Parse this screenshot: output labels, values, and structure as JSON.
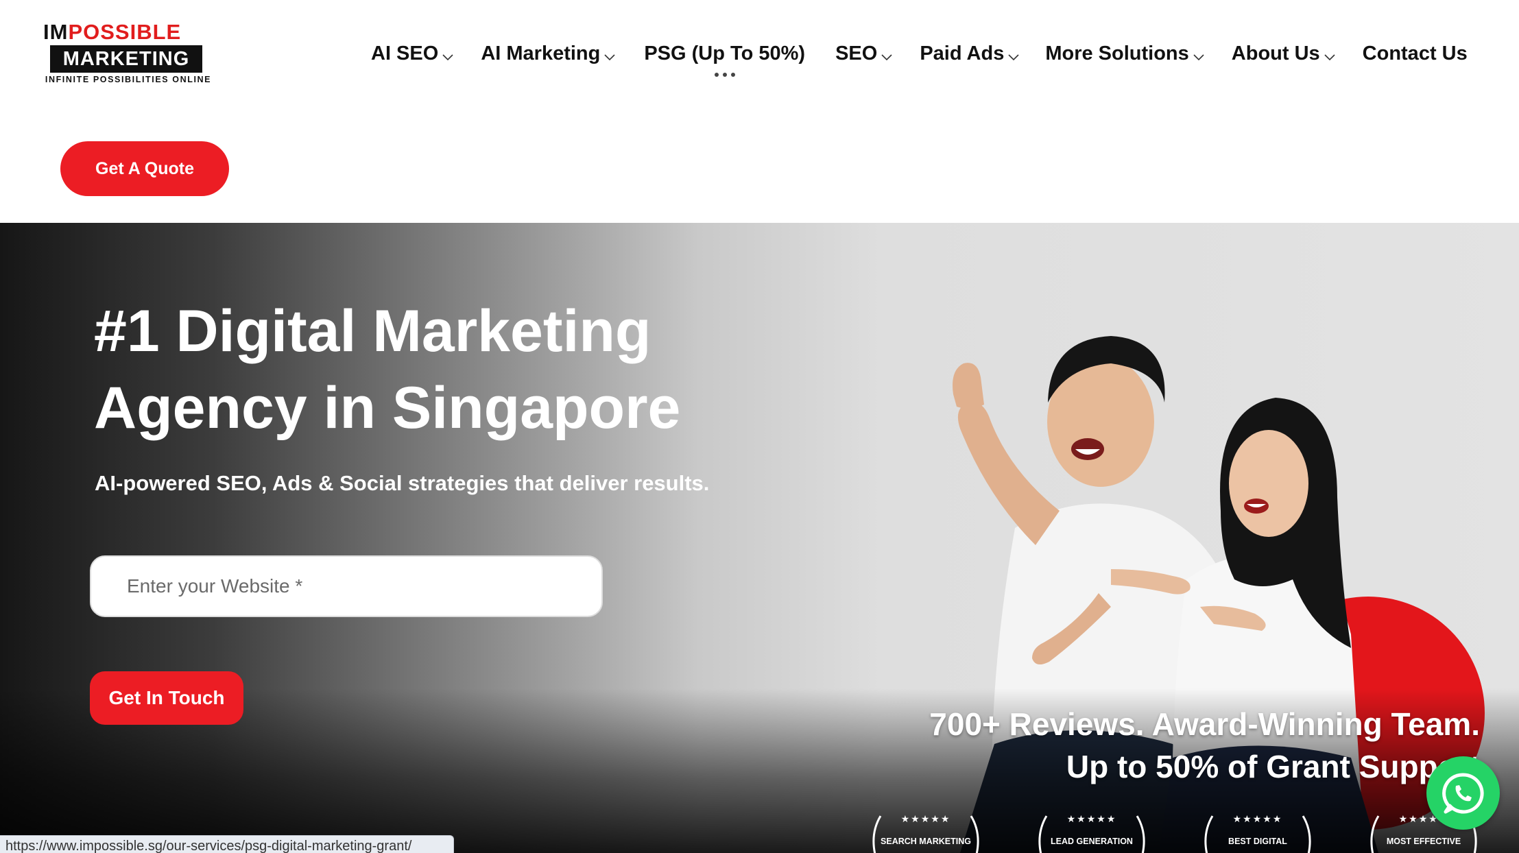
{
  "logo": {
    "line1_im": "IM",
    "line1_possible": "POSSIBLE",
    "line2": "MARKETING",
    "tagline": "INFINITE POSSIBILITIES ONLINE"
  },
  "nav": {
    "items": [
      {
        "label": "AI SEO",
        "has_dropdown": true
      },
      {
        "label": "AI Marketing",
        "has_dropdown": true
      },
      {
        "label": "PSG (Up To 50%)",
        "has_dropdown": false
      },
      {
        "label": "SEO",
        "has_dropdown": true
      },
      {
        "label": "Paid Ads",
        "has_dropdown": true
      },
      {
        "label": "More Solutions",
        "has_dropdown": true
      },
      {
        "label": "About Us",
        "has_dropdown": true
      },
      {
        "label": "Contact Us",
        "has_dropdown": false
      }
    ]
  },
  "header": {
    "quote_button": "Get A Quote"
  },
  "hero": {
    "title_line1": "#1 Digital Marketing",
    "title_line2": "Agency in Singapore",
    "subtitle": "AI-powered SEO, Ads & Social strategies that deliver results.",
    "website_placeholder": "Enter your Website *",
    "website_value": "",
    "cta_button": "Get In Touch",
    "reviews_line1": "700+ Reviews. Award-Winning Team.",
    "reviews_line2": "Up to 50% of Grant Support"
  },
  "awards": [
    {
      "stars": "★★★★★",
      "label": "SEARCH MARKETING"
    },
    {
      "stars": "★★★★★",
      "label": "LEAD GENERATION"
    },
    {
      "stars": "★★★★★",
      "label": "BEST DIGITAL"
    },
    {
      "stars": "★★★★★",
      "label": "MOST EFFECTIVE"
    }
  ],
  "status_bar": {
    "url": "https://www.impossible.sg/our-services/psg-digital-marketing-grant/"
  },
  "colors": {
    "brand_red": "#ec1d24",
    "logo_red": "#e11d1d",
    "whatsapp_green": "#25d366",
    "text_dark": "#111111"
  },
  "icons": {
    "dropdown": "chevron-down-icon",
    "whatsapp": "whatsapp-icon",
    "laurel": "laurel-icon"
  }
}
